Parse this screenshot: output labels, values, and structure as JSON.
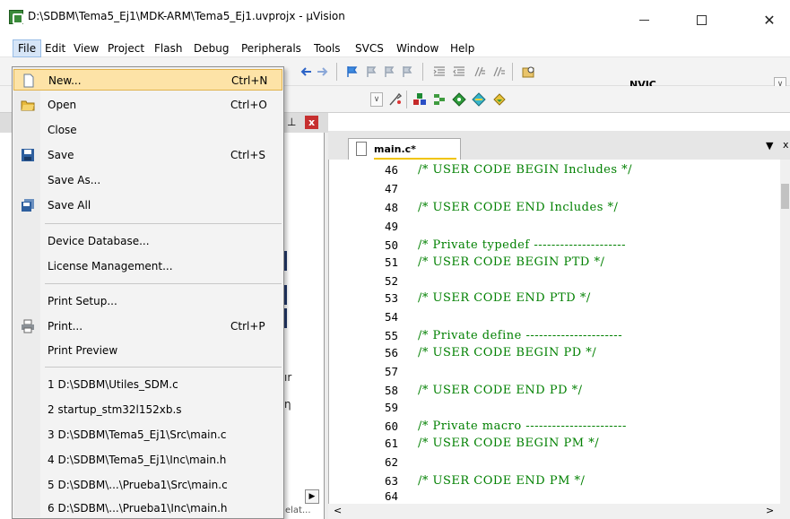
{
  "window": {
    "title": "D:\\SDBM\\Tema5_Ej1\\MDK-ARM\\Tema5_Ej1.uvprojx - µVision",
    "minimize_glyph": "—",
    "maximize_glyph": "☐",
    "close_glyph": "✕"
  },
  "menubar": {
    "items": [
      "File",
      "Edit",
      "View",
      "Project",
      "Flash",
      "Debug",
      "Peripherals",
      "Tools",
      "SVCS",
      "Window",
      "Help"
    ]
  },
  "toolbar": {
    "nvic_label": "NVIC",
    "dropdown_glyph": "∨"
  },
  "file_menu": {
    "items": [
      {
        "label": "New...",
        "shortcut": "Ctrl+N",
        "icon": "new-file-icon",
        "highlighted": true
      },
      {
        "label": "Open",
        "shortcut": "Ctrl+O",
        "icon": "open-folder-icon"
      },
      {
        "label": "Close",
        "shortcut": ""
      },
      {
        "label": "Save",
        "shortcut": "Ctrl+S",
        "icon": "save-icon"
      },
      {
        "label": "Save As...",
        "shortcut": ""
      },
      {
        "label": "Save All",
        "shortcut": "",
        "icon": "save-all-icon"
      },
      {
        "label": "Device Database...",
        "shortcut": ""
      },
      {
        "label": "License Management...",
        "shortcut": ""
      },
      {
        "label": "Print Setup...",
        "shortcut": ""
      },
      {
        "label": "Print...",
        "shortcut": "Ctrl+P",
        "icon": "print-icon"
      },
      {
        "label": "Print Preview",
        "shortcut": ""
      },
      {
        "label": "1 D:\\SDBM\\Utiles_SDM.c",
        "shortcut": ""
      },
      {
        "label": "2 startup_stm32l152xb.s",
        "shortcut": ""
      },
      {
        "label": "3 D:\\SDBM\\Tema5_Ej1\\Src\\main.c",
        "shortcut": ""
      },
      {
        "label": "4 D:\\SDBM\\Tema5_Ej1\\Inc\\main.h",
        "shortcut": ""
      },
      {
        "label": "5 D:\\SDBM\\...\\Prueba1\\Src\\main.c",
        "shortcut": ""
      },
      {
        "label": "6 D:\\SDBM\\...\\Prueba1\\Inc\\main.h",
        "shortcut": ""
      }
    ]
  },
  "project_pane": {
    "close_glyph": "x",
    "pin_glyph": "⊥",
    "bottom_tab_fragment": "elat...",
    "scroll_right_glyph": "▶",
    "scroll_left_glyph": "<",
    "text_fragments": [
      "ır",
      "ƞ"
    ]
  },
  "editor": {
    "tab_label": "main.c*",
    "tabs_dropdown_glyph": "▼",
    "tabs_close_glyph": "x",
    "line_numbers": [
      "46",
      "47",
      "48",
      "49",
      "50",
      "51",
      "52",
      "53",
      "54",
      "55",
      "56",
      "57",
      "58",
      "59",
      "60",
      "61",
      "62",
      "63",
      "64"
    ],
    "lines": [
      "/* USER CODE BEGIN Includes */",
      "",
      "/* USER CODE END Includes */",
      "",
      "/* Private typedef ---------------------",
      "/* USER CODE BEGIN PTD */",
      "",
      "/* USER CODE END PTD */",
      "",
      "/* Private define ----------------------",
      "/* USER CODE BEGIN PD */",
      "",
      "/* USER CODE END PD */",
      "",
      "/* Private macro -----------------------",
      "/* USER CODE BEGIN PM */",
      "",
      "/* USER CODE END PM */",
      ""
    ],
    "scroll_right_glyph": ">"
  }
}
